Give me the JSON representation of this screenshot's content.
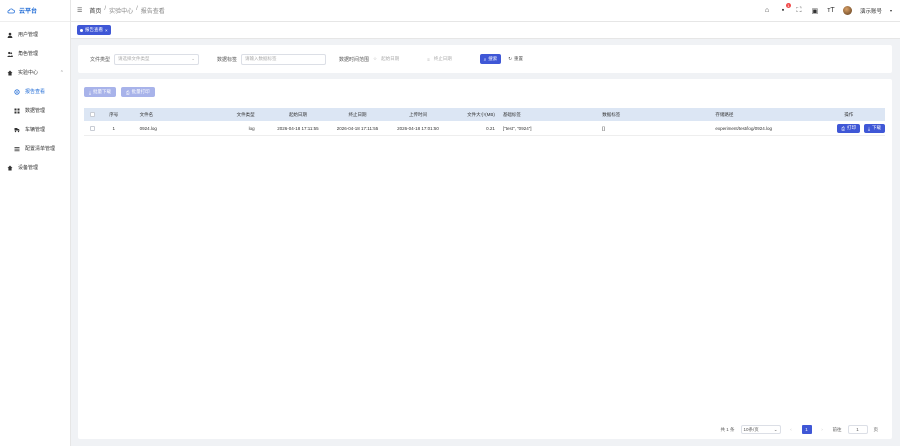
{
  "app": {
    "title": "云平台"
  },
  "sidebar": {
    "items": [
      {
        "label": "用户管理",
        "icon": "user-icon"
      },
      {
        "label": "角色管理",
        "icon": "role-icon"
      },
      {
        "label": "实验中心",
        "icon": "home-icon",
        "expanded": true
      },
      {
        "label": "报告查看",
        "icon": "report-icon",
        "active": true
      },
      {
        "label": "数据管理",
        "icon": "grid-icon"
      },
      {
        "label": "车辆管理",
        "icon": "vehicle-icon"
      },
      {
        "label": "配置清单管理",
        "icon": "list-icon"
      },
      {
        "label": "设备管理",
        "icon": "device-icon"
      }
    ]
  },
  "header": {
    "breadcrumb": [
      "首页",
      "实验中心",
      "报告查看"
    ],
    "notification_count": "1",
    "username": "演示账号"
  },
  "tags": [
    {
      "label": "报告查看"
    }
  ],
  "search": {
    "file_type_label": "文件类型",
    "file_type_placeholder": "请选择文件类型",
    "data_tag_label": "数据标签",
    "data_tag_placeholder": "请输入数据标签",
    "time_range_label": "数据时间范围",
    "start_placeholder": "起始日期",
    "end_placeholder": "终止日期",
    "search_button": "搜索",
    "reset_button": "重置"
  },
  "toolbar": {
    "batch_download": "批量下载",
    "batch_print": "批量打印"
  },
  "table": {
    "headers": [
      "序号",
      "文件名",
      "文件类型",
      "起始日期",
      "终止日期",
      "上传时间",
      "文件大小(MB)",
      "基础标签",
      "数据标签",
      "存储路径",
      "操作"
    ],
    "rows": [
      {
        "seq": "1",
        "name": "0924.log",
        "type": "log",
        "start": "2026-04-18 17:11:55",
        "end": "2026-04-18 17:11:55",
        "upload": "2026-04-18 17:01:50",
        "size": "0.21",
        "base_tags": "[\"test\", \"0924\"]",
        "data_tags": "[]",
        "path": "experiment/test/log/0924.log"
      }
    ],
    "row_actions": {
      "print": "打印",
      "download": "下载"
    }
  },
  "pagination": {
    "total": "共 1 条",
    "page_size": "10条/页",
    "current_page": "1",
    "goto_label": "前往",
    "goto_value": "1",
    "page_suffix": "页"
  },
  "colors": {
    "primary": "#3f57d6",
    "header_bg": "#dce6f4",
    "brand": "#1f6bd6",
    "badge": "#f04848"
  }
}
